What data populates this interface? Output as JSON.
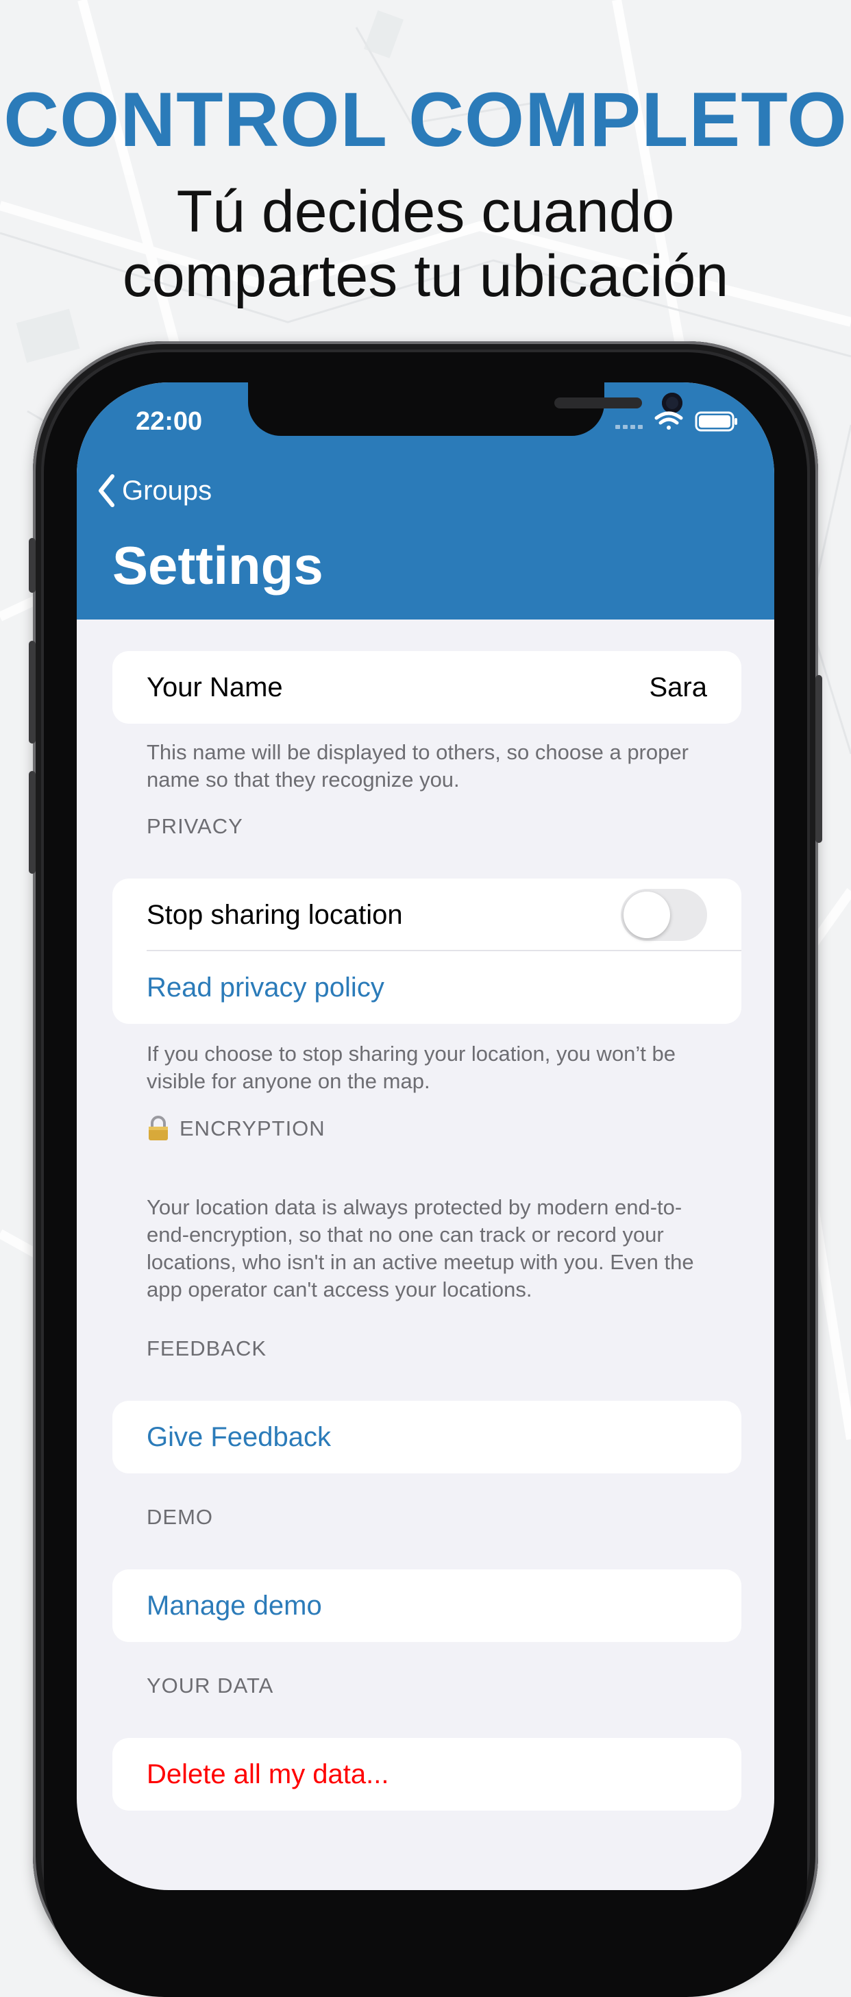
{
  "promo": {
    "headline": "CONTROL COMPLETO",
    "subline_1": "Tú decides cuando",
    "subline_2": "compartes tu ubicación"
  },
  "status_bar": {
    "time": "22:00",
    "icons": [
      "cellular-signal-icon",
      "wifi-icon",
      "battery-icon"
    ]
  },
  "nav": {
    "back_label": "Groups",
    "title": "Settings"
  },
  "name_section": {
    "label": "Your Name",
    "value": "Sara",
    "footnote": "This name will be displayed to others, so choose a proper name so that they recognize you."
  },
  "privacy_section": {
    "header": "PRIVACY",
    "toggle_label": "Stop sharing location",
    "toggle_on": false,
    "link": "Read privacy policy",
    "footnote": "If you choose to stop sharing your location, you won’t be visible for anyone on the map."
  },
  "encryption_section": {
    "icon": "lock-icon",
    "header": "ENCRYPTION",
    "body": "Your location data is always protected by modern end-to-end-encryption, so that no one can track or record your locations, who isn't in an active meetup with you. Even the app operator can't access your locations."
  },
  "feedback_section": {
    "header": "FEEDBACK",
    "link": "Give Feedback"
  },
  "demo_section": {
    "header": "DEMO",
    "link": "Manage demo"
  },
  "data_section": {
    "header": "YOUR DATA",
    "link": "Delete all my data..."
  },
  "colors": {
    "accent": "#2b7bb9",
    "danger": "#ff0000",
    "grouped_background": "#f2f2f7",
    "secondary_text": "#6d6d72"
  }
}
